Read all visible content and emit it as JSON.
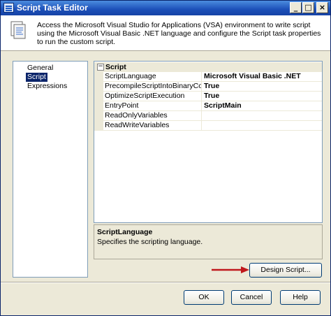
{
  "window": {
    "title": "Script Task Editor"
  },
  "header": {
    "description": "Access the Microsoft Visual Studio for Applications (VSA) environment to write script using the Microsoft Visual Basic .NET language and configure the Script task properties to run the custom script."
  },
  "nav": {
    "items": [
      {
        "label": "General",
        "selected": false
      },
      {
        "label": "Script",
        "selected": true
      },
      {
        "label": "Expressions",
        "selected": false
      }
    ]
  },
  "grid": {
    "category": {
      "toggle": "⊟",
      "label": "Script"
    },
    "properties": [
      {
        "name": "ScriptLanguage",
        "value": "Microsoft Visual Basic .NET"
      },
      {
        "name": "PrecompileScriptIntoBinaryCode",
        "value": "True"
      },
      {
        "name": "OptimizeScriptExecution",
        "value": "True"
      },
      {
        "name": "EntryPoint",
        "value": "ScriptMain"
      },
      {
        "name": "ReadOnlyVariables",
        "value": ""
      },
      {
        "name": "ReadWriteVariables",
        "value": ""
      }
    ]
  },
  "description_panel": {
    "title": "ScriptLanguage",
    "text": "Specifies the scripting language."
  },
  "buttons": {
    "design_script": "Design Script...",
    "ok": "OK",
    "cancel": "Cancel",
    "help": "Help"
  },
  "colors": {
    "titlebar": "#1c4fb8",
    "selection": "#0a246a",
    "arrow": "#c0181c"
  }
}
